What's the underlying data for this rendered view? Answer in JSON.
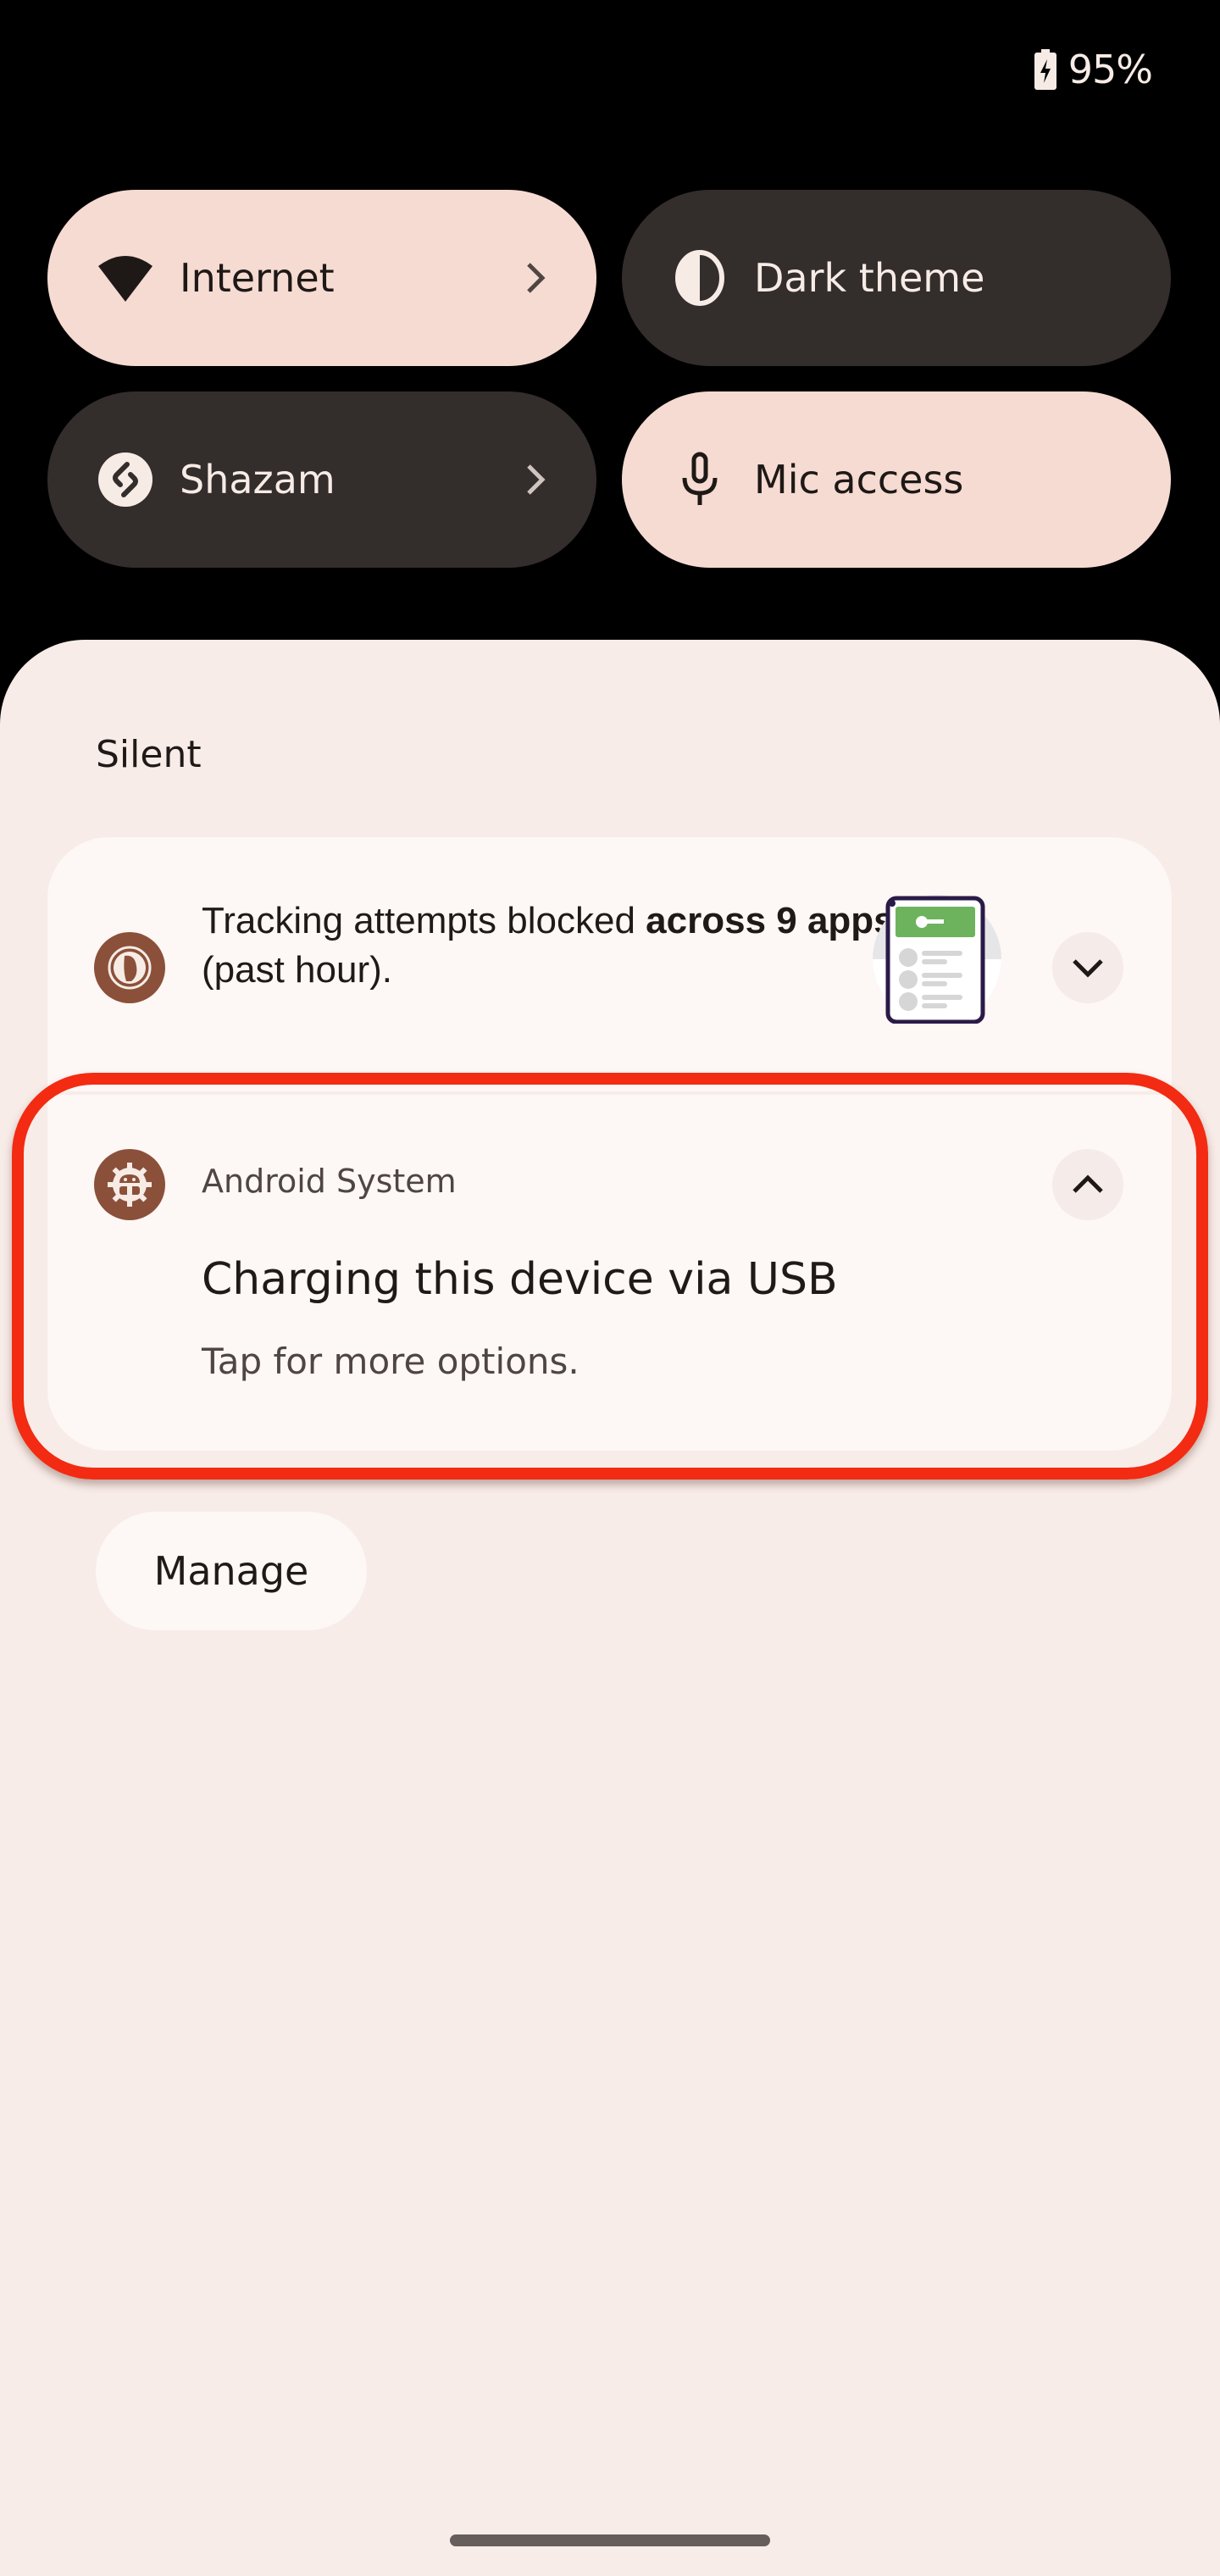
{
  "status_bar": {
    "battery_icon": "battery-charging-icon",
    "battery_percent": "95%"
  },
  "quick_settings": {
    "tiles": [
      {
        "label": "Internet",
        "icon": "wifi-icon",
        "state": "on",
        "has_chevron": true
      },
      {
        "label": "Dark theme",
        "icon": "contrast-icon",
        "state": "off",
        "has_chevron": false
      },
      {
        "label": "Shazam",
        "icon": "shazam-icon",
        "state": "off",
        "has_chevron": true
      },
      {
        "label": "Mic access",
        "icon": "microphone-icon",
        "state": "on",
        "has_chevron": false
      }
    ]
  },
  "notifications": {
    "section_title": "Silent",
    "items": [
      {
        "app_icon": "duckduckgo-icon",
        "text_prefix": "Tracking attempts blocked ",
        "text_bold_1": "across 9 apps",
        "text_suffix": " (past hour).",
        "thumbnail": "app-tracking-illustration",
        "expand_icon": "chevron-down-icon"
      },
      {
        "app_icon": "android-system-icon",
        "app_name": "Android System",
        "title": "Charging this device via USB",
        "body": "Tap for more options.",
        "expand_icon": "chevron-up-icon",
        "highlighted": true
      }
    ],
    "manage_label": "Manage"
  },
  "colors": {
    "tile_on": "#f6dbd2",
    "tile_off": "#332d2b",
    "shade_bg": "#f8ece8",
    "card_bg": "#fdf7f5",
    "app_icon_bg": "#8b5039",
    "highlight": "#f22b12"
  }
}
